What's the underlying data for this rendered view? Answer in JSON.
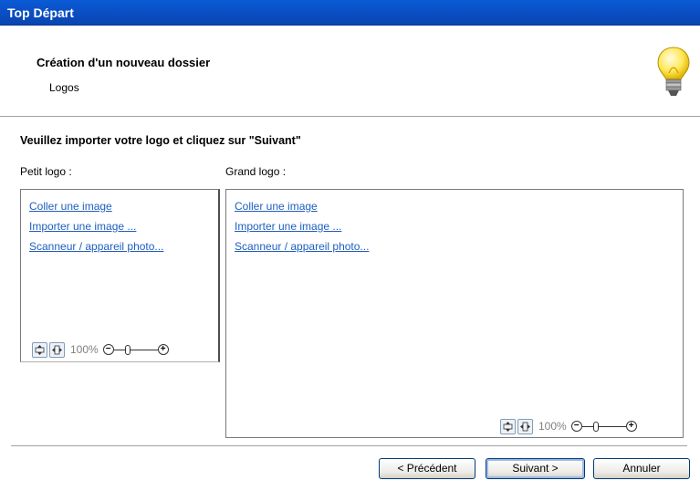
{
  "window": {
    "title": "Top Départ"
  },
  "header": {
    "heading": "Création d'un nouveau dossier",
    "subheading": "Logos",
    "icon": "lightbulb-icon"
  },
  "main": {
    "instruction": "Veuillez importer votre logo et cliquez sur \"Suivant\"",
    "small_logo": {
      "label": "Petit logo :",
      "links": [
        "Coller une image",
        "Importer une image ...",
        "Scanneur / appareil photo..."
      ],
      "zoom": "100%"
    },
    "large_logo": {
      "label": "Grand logo :",
      "links": [
        "Coller une image",
        "Importer une image ...",
        "Scanneur / appareil photo..."
      ],
      "zoom": "100%"
    }
  },
  "footer": {
    "prev_label": "< Précédent",
    "next_label": "Suivant >",
    "cancel_label": "Annuler"
  },
  "colors": {
    "titlebar": "#0b4fc4",
    "link": "#1f5fbf"
  }
}
